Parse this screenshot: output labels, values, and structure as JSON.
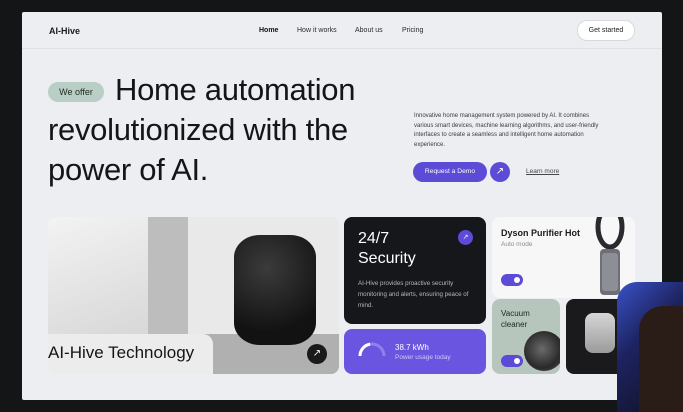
{
  "nav": {
    "logo": "AI-Hive",
    "links": [
      "Home",
      "How it works",
      "About us",
      "Pricing"
    ],
    "active": "Home",
    "cta": "Get started"
  },
  "hero": {
    "badge": "We offer",
    "headline_line1": "Home automation",
    "headline_line2": "revolutionized with the",
    "headline_line3": "power of AI.",
    "description": "Innovative home management system powered by AI. It combines various smart devices, machine learning algorithms, and user-friendly interfaces to create a seamless and intelligent home automation experience.",
    "demo_button": "Request a Demo",
    "learn_more": "Learn more"
  },
  "cards": {
    "technology": {
      "label": "AI-Hive Technology"
    },
    "security": {
      "title_line1": "24/7",
      "title_line2": "Security",
      "text": "AI-Hive provides proactive security monitoring and alerts, ensuring peace of mind."
    },
    "power": {
      "value": "38.7 kWh",
      "label": "Power usage today",
      "gauge_fraction": 0.45
    },
    "purifier": {
      "title": "Dyson Purifier Hot",
      "subtitle": "Auto mode",
      "toggle_on": true
    },
    "vacuum": {
      "title_line1": "Vacuum",
      "title_line2": "cleaner",
      "toggle_on": true
    }
  },
  "colors": {
    "accent": "#5b4bd6",
    "badge": "#b9cec5",
    "dark_card": "#16171b",
    "page_bg": "#eceef2"
  },
  "icons": {
    "arrow": "north-east-arrow"
  }
}
